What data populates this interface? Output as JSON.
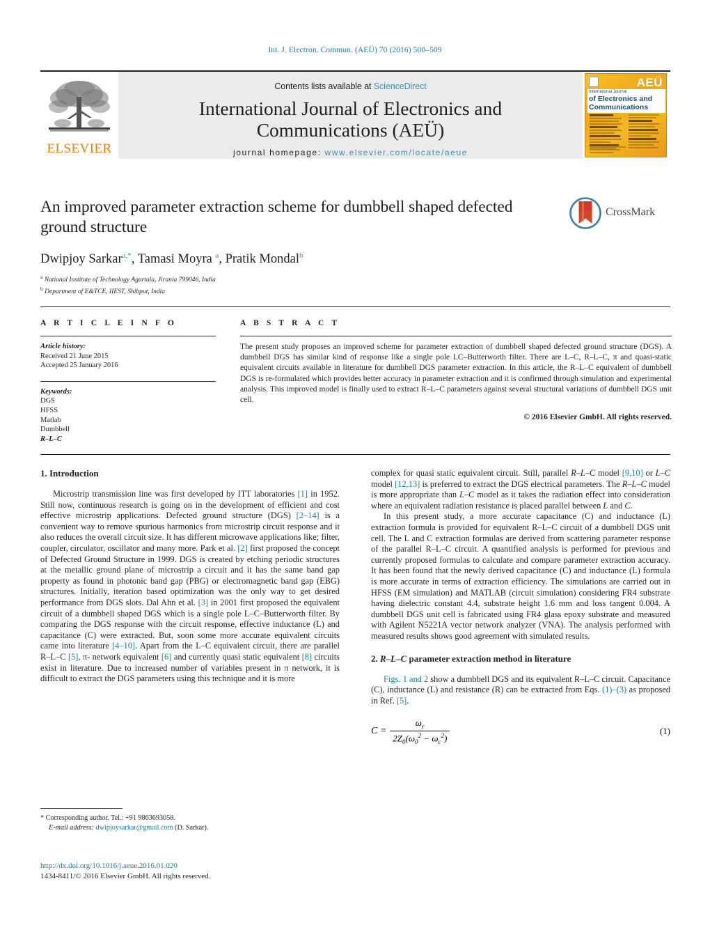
{
  "running_head": "Int. J. Electron. Commun. (AEÜ) 70 (2016) 500–509",
  "masthead": {
    "publisher_logo_label": "ELSEVIER",
    "contents_prefix": "Contents lists available at ",
    "contents_link": "ScienceDirect",
    "journal_title_line1": "International Journal of Electronics and",
    "journal_title_line2": "Communications (AEÜ)",
    "homepage_prefix": "journal homepage:",
    "homepage_url": "www.elsevier.com/locate/aeue",
    "cover": {
      "aeu_mark": "AEÜ",
      "band_line1": "International Journal",
      "band_line2": "of Electronics and",
      "band_line3": "Communications"
    }
  },
  "article": {
    "title": "An improved parameter extraction scheme for dumbbell shaped defected ground structure",
    "authors_html": "Dwipjoy Sarkar<sup>a,*</sup>, Tamasi Moyra <sup>a</sup>, Pratik Mondal<sup>b</sup>",
    "affiliation_a_marker": "a",
    "affiliation_a": "National Institute of Technology Agartala, Jirania 799046, India",
    "affiliation_b_marker": "b",
    "affiliation_b": "Department of E&TCE, IIEST, Shibpur, India",
    "crossmark_label": "CrossMark"
  },
  "article_info": {
    "heading": "A R T I C L E   I N F O",
    "history_label": "Article history:",
    "received": "Received 21 June 2015",
    "accepted": "Accepted 25 January 2016",
    "keywords_label": "Keywords:",
    "keywords": [
      "DGS",
      "HFSS",
      "Matlab",
      "Dumbbell",
      "R–L–C"
    ]
  },
  "abstract": {
    "heading": "A B S T R A C T",
    "text": "The present study proposes an improved scheme for parameter extraction of dumbbell shaped defected ground structure (DGS). A dumbbell DGS has similar kind of response like a single pole LC–Butterworth filter. There are L–C, R–L–C, π and quasi-static equivalent circuits available in literature for dumbbell DGS parameter extraction. In this article, the R–L–C equivalent of dumbbell DGS is re-formulated which provides better accuracy in parameter extraction and it is confirmed through simulation and experimental analysis. This improved model is finally used to extract R–L–C parameters against several structural variations of dumbbell DGS unit cell.",
    "copyright": "© 2016 Elsevier GmbH. All rights reserved."
  },
  "sections": {
    "introduction": {
      "number": "1.",
      "title": "Introduction",
      "paragraph_1_part_1": "Microstrip transmission line was first developed by ITT laboratories ",
      "ref_1": "[1]",
      "paragraph_1_part_2": " in 1952. Still now, continuous research is going on in the development of efficient and cost effective microstrip applications. Defected ground structure (DGS) ",
      "ref_2_14": "[2–14]",
      "paragraph_1_part_3": " is a convenient way to remove spurious harmonics from microstrip circuit response and it also reduces the overall circuit size. It has different microwave applications like; filter, coupler, circulator, oscillator and many more. Park et al. ",
      "ref_2": "[2]",
      "paragraph_1_part_4": " first proposed the concept of Defected Ground Structure in 1999. DGS is created by etching periodic structures at the metallic ground plane of microstrip a circuit and it has the same band gap property as found in photonic band gap (PBG) or electromagnetic band gap (EBG) structures. Initially, iteration based optimization was the only way to get desired performance from DGS slots. Dal Ahn et al. ",
      "ref_3": "[3]",
      "paragraph_1_part_5": " in 2001 first proposed the equivalent circuit of a dumbbell shaped DGS which is a single pole L–C–Butterworth filter. By comparing the DGS response with the circuit response, effective inductance (L) and capacitance (C) were extracted. But, soon some more accurate equivalent circuits came into literature ",
      "ref_4_10": "[4–10]",
      "paragraph_1_part_6": ". Apart from the L–C equivalent circuit, there are parallel R–L–C ",
      "ref_5": "[5]",
      "paragraph_1_part_7": ", π- network equivalent ",
      "ref_6": "[6]",
      "paragraph_1_part_8": " and currently quasi static equivalent ",
      "ref_8": "[8]",
      "paragraph_1_part_9": " circuits exist in literature. Due to increased number of variables present in π network, it is difficult to extract the DGS parameters using this technique and it is more complex for quasi static equivalent circuit. Still, parallel R–L–C model ",
      "ref_9_10": "[9,10]",
      "paragraph_1_part_10": " or L–C model ",
      "ref_12_13": "[12,13]",
      "paragraph_1_part_11": " is preferred to extract the DGS electrical parameters. The R–L–C model is more appropriate than L–C model as it takes the radiation effect into consideration where an equivalent radiation resistance is placed parallel between L and C.",
      "paragraph_2": "In this present study, a more accurate capacitance (C) and inductance (L) extraction formula is provided for equivalent R–L–C circuit of a dumbbell DGS unit cell. The L and C extraction formulas are derived from scattering parameter response of the parallel R–L–C circuit. A quantified analysis is performed for previous and currently proposed formulas to calculate and compare parameter extraction accuracy. It has been found that the newly derived capacitance (C) and inductance (L) formula is more accurate in terms of extraction efficiency. The simulations are carried out in HFSS (EM simulation) and MATLAB (circuit simulation) considering FR4 substrate having dielectric constant 4.4, substrate height 1.6 mm and loss tangent 0.004. A dumbbell DGS unit cell is fabricated using FR4 glass epoxy substrate and measured with Agilent N5221A vector network analyzer (VNA). The analysis performed with measured results shows good agreement with simulated results."
    },
    "method": {
      "number": "2.",
      "title_italic": "R–L–C",
      "title_rest": " parameter extraction method in literature",
      "paragraph_ref_figs": "Figs. 1 and 2",
      "paragraph_part_1": " show a dumbbell DGS and its equivalent R–L–C circuit. Capacitance (C), inductance (L) and resistance (R) can be extracted from Eqs. ",
      "ref_eq_1_3": "(1)–(3)",
      "paragraph_part_2": " as proposed in Ref. ",
      "ref_5": "[5]",
      "paragraph_part_3": "."
    }
  },
  "equation_1": {
    "lhs": "C =",
    "numerator": "ωc",
    "denominator": "2Z0(ω0² − ωc²)",
    "number": "(1)"
  },
  "footnote": {
    "star": "*",
    "corresponding": " Corresponding author. Tel.: +91 9863693058.",
    "email_label": "E-mail address:",
    "email": "dwipjoysarkar@gmail.com",
    "email_suffix": " (D. Sarkar)."
  },
  "footer": {
    "doi": "http://dx.doi.org/10.1016/j.aeue.2016.01.020",
    "issn_line": "1434-8411/© 2016 Elsevier GmbH. All rights reserved."
  },
  "colors": {
    "link": "#1f7ba5",
    "elsevier_orange": "#ef7d00",
    "panel_grey": "#ebebeb",
    "text": "#231f20"
  }
}
